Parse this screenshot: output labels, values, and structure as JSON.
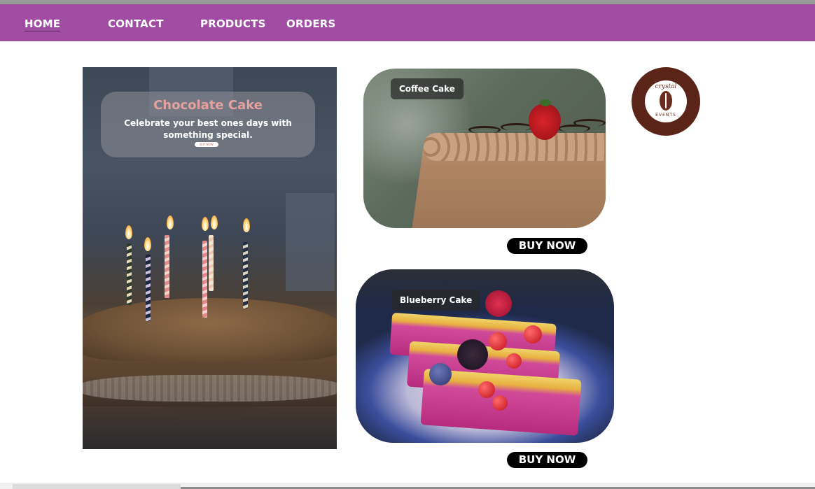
{
  "nav": {
    "items": [
      {
        "label": "HOME"
      },
      {
        "label": "CONTACT"
      },
      {
        "label": "PRODUCTS"
      },
      {
        "label": "ORDERS"
      }
    ],
    "active": "HOME",
    "background": "#a04ca3"
  },
  "hero": {
    "title": "Chocolate Cake",
    "subtitle": "Celebrate your best ones days with something special.",
    "button_label": "BUY NOW"
  },
  "products": [
    {
      "name": "Coffee Cake",
      "button_label": "BUY NOW"
    },
    {
      "name": "Blueberry Cake",
      "button_label": "BUY NOW"
    }
  ],
  "logo": {
    "script_text": "crystal",
    "sub_text": "EVENTS"
  },
  "colors": {
    "accent": "#a04ca3",
    "hero_title": "#e5a0a0",
    "button": "#000000",
    "logo": "#5a2418"
  }
}
